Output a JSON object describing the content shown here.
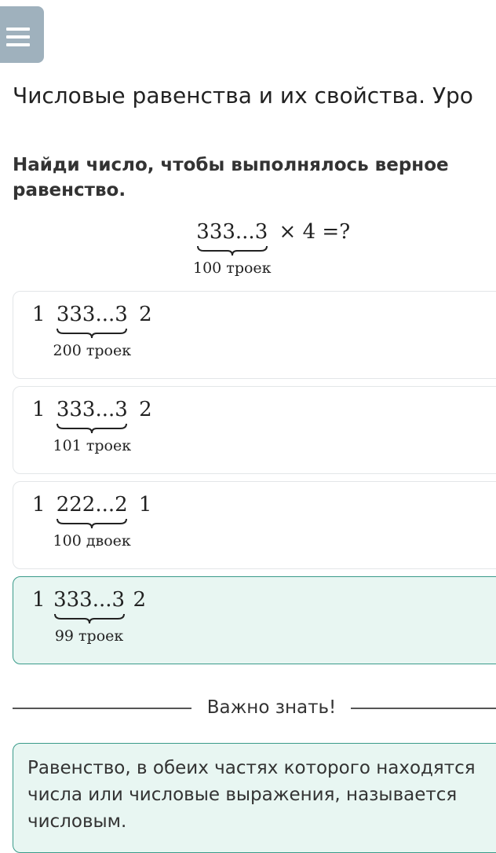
{
  "header": {
    "menu_icon": "hamburger-menu-icon",
    "lesson_title": "Числовые равенства и их свойства. Уро"
  },
  "task": {
    "instruction": "Найди число, чтобы выполнялось верное равенство.",
    "equation": {
      "number": "333...3",
      "brace_label": "100 троек",
      "rest": "× 4 =?"
    }
  },
  "options": [
    {
      "prefix": "1",
      "number": "333...3",
      "suffix": "2",
      "brace_label": "200 троек",
      "selected": false
    },
    {
      "prefix": "1",
      "number": "333...3",
      "suffix": "2",
      "brace_label": "101 троек",
      "selected": false
    },
    {
      "prefix": "1",
      "number": "222...2",
      "suffix": "1",
      "brace_label": "100 двоек",
      "selected": false
    },
    {
      "prefix": "1",
      "number": "333...3",
      "suffix": "2",
      "brace_label": "99 троек",
      "selected": true
    }
  ],
  "important": {
    "heading": "Важно знать!",
    "text": "Равенство, в обеих частях которого находятся числа или числовые выражения, называется числовым."
  },
  "colors": {
    "menu_button": "#9fb1bd",
    "correct_border": "#3a9b8a",
    "correct_background": "#e8f6f2",
    "option_border": "#e3e6e8"
  }
}
